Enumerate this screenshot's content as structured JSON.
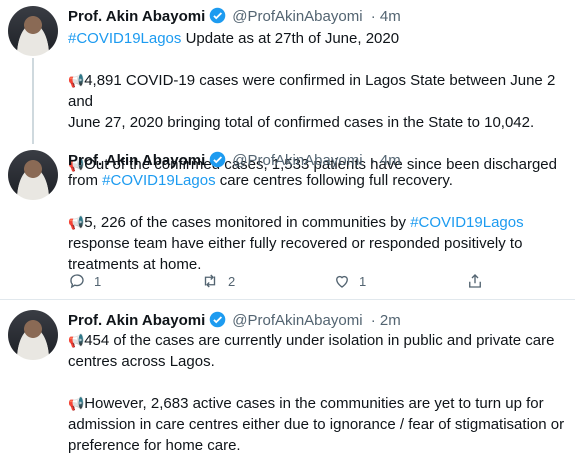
{
  "author": {
    "name": "Prof. Akin Abayomi",
    "handle": "@ProfAkinAbayomi",
    "verified_icon": "verified-badge-icon"
  },
  "tweets": [
    {
      "time": "· 4m",
      "line1_tag": "#COVID19Lagos",
      "line1_rest": " Update as at 27th of June, 2020",
      "p1a": "4,891 COVID-19 cases were confirmed in Lagos State between June 2 and",
      "p1b": "June 27, 2020 bringing total of confirmed cases in the State to 10,042.",
      "p2": "Out of the confirmed cases, 1,533 patients have since been discharged"
    },
    {
      "time": "· 4m",
      "l1_pre": "from ",
      "l1_tag": "#COVID19Lagos",
      "l1_post": " care centres following full recovery.",
      "p2_pre": "5, 226 of the cases monitored in communities by ",
      "p2_tag": "#COVID19Lagos",
      "p2b": "response team have either fully recovered or responded positively to",
      "p2c": "treatments at home."
    },
    {
      "time": "· 2m",
      "p1a": "454 of the cases are currently under isolation in public and private care",
      "p1b": "centres across Lagos.",
      "p2a": "However, 2,683 active cases in the communities are yet to turn up for",
      "p2b": "admission in care centres either due to  ignorance / fear of stigmatisation or",
      "p2c": "preference for home care."
    }
  ],
  "actions": {
    "reply_count": "1",
    "retweet_count": "2",
    "like_count": "1",
    "icons": [
      "reply-icon",
      "retweet-icon",
      "like-icon",
      "share-icon"
    ]
  },
  "colors": {
    "accent": "#1d9bf0",
    "muted": "#536471",
    "megaphone": "#d9262e"
  }
}
